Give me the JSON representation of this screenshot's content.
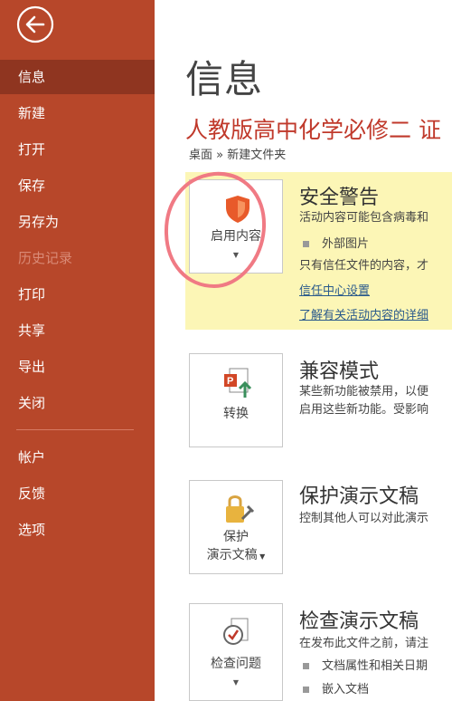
{
  "sidebar": {
    "items": [
      {
        "label": "信息"
      },
      {
        "label": "新建"
      },
      {
        "label": "打开"
      },
      {
        "label": "保存"
      },
      {
        "label": "另存为"
      },
      {
        "label": "历史记录"
      },
      {
        "label": "打印"
      },
      {
        "label": "共享"
      },
      {
        "label": "导出"
      },
      {
        "label": "关闭"
      },
      {
        "label": "帐户"
      },
      {
        "label": "反馈"
      },
      {
        "label": "选项"
      }
    ],
    "active_color": "#8f3520",
    "background": "#b7472a"
  },
  "main": {
    "title": "信息",
    "doc_title": "人教版高中化学必修二 证",
    "breadcrumb": "桌面 » 新建文件夹"
  },
  "sections": {
    "security": {
      "button_label": "启用内容",
      "heading": "安全警告",
      "line1": "活动内容可能包含病毒和",
      "bullet": "外部图片",
      "line2": "只有信任文件的内容，才",
      "link1": "信任中心设置",
      "link2": "了解有关活动内容的详细"
    },
    "compat": {
      "button_label": "转换",
      "heading": "兼容模式",
      "line1": "某些新功能被禁用，以便",
      "line2": "启用这些新功能。受影响"
    },
    "protect": {
      "button_label_1": "保护",
      "button_label_2": "演示文稿",
      "heading": "保护演示文稿",
      "line1": "控制其他人可以对此演示"
    },
    "inspect": {
      "button_label": "检查问题",
      "heading": "检查演示文稿",
      "line1": "在发布此文件之前，请注",
      "bullet1": "文档属性和相关日期",
      "bullet2": "嵌入文档"
    }
  },
  "icons": [
    "back-arrow-icon",
    "shield-icon",
    "convert-icon",
    "lock-icon",
    "inspect-icon"
  ]
}
